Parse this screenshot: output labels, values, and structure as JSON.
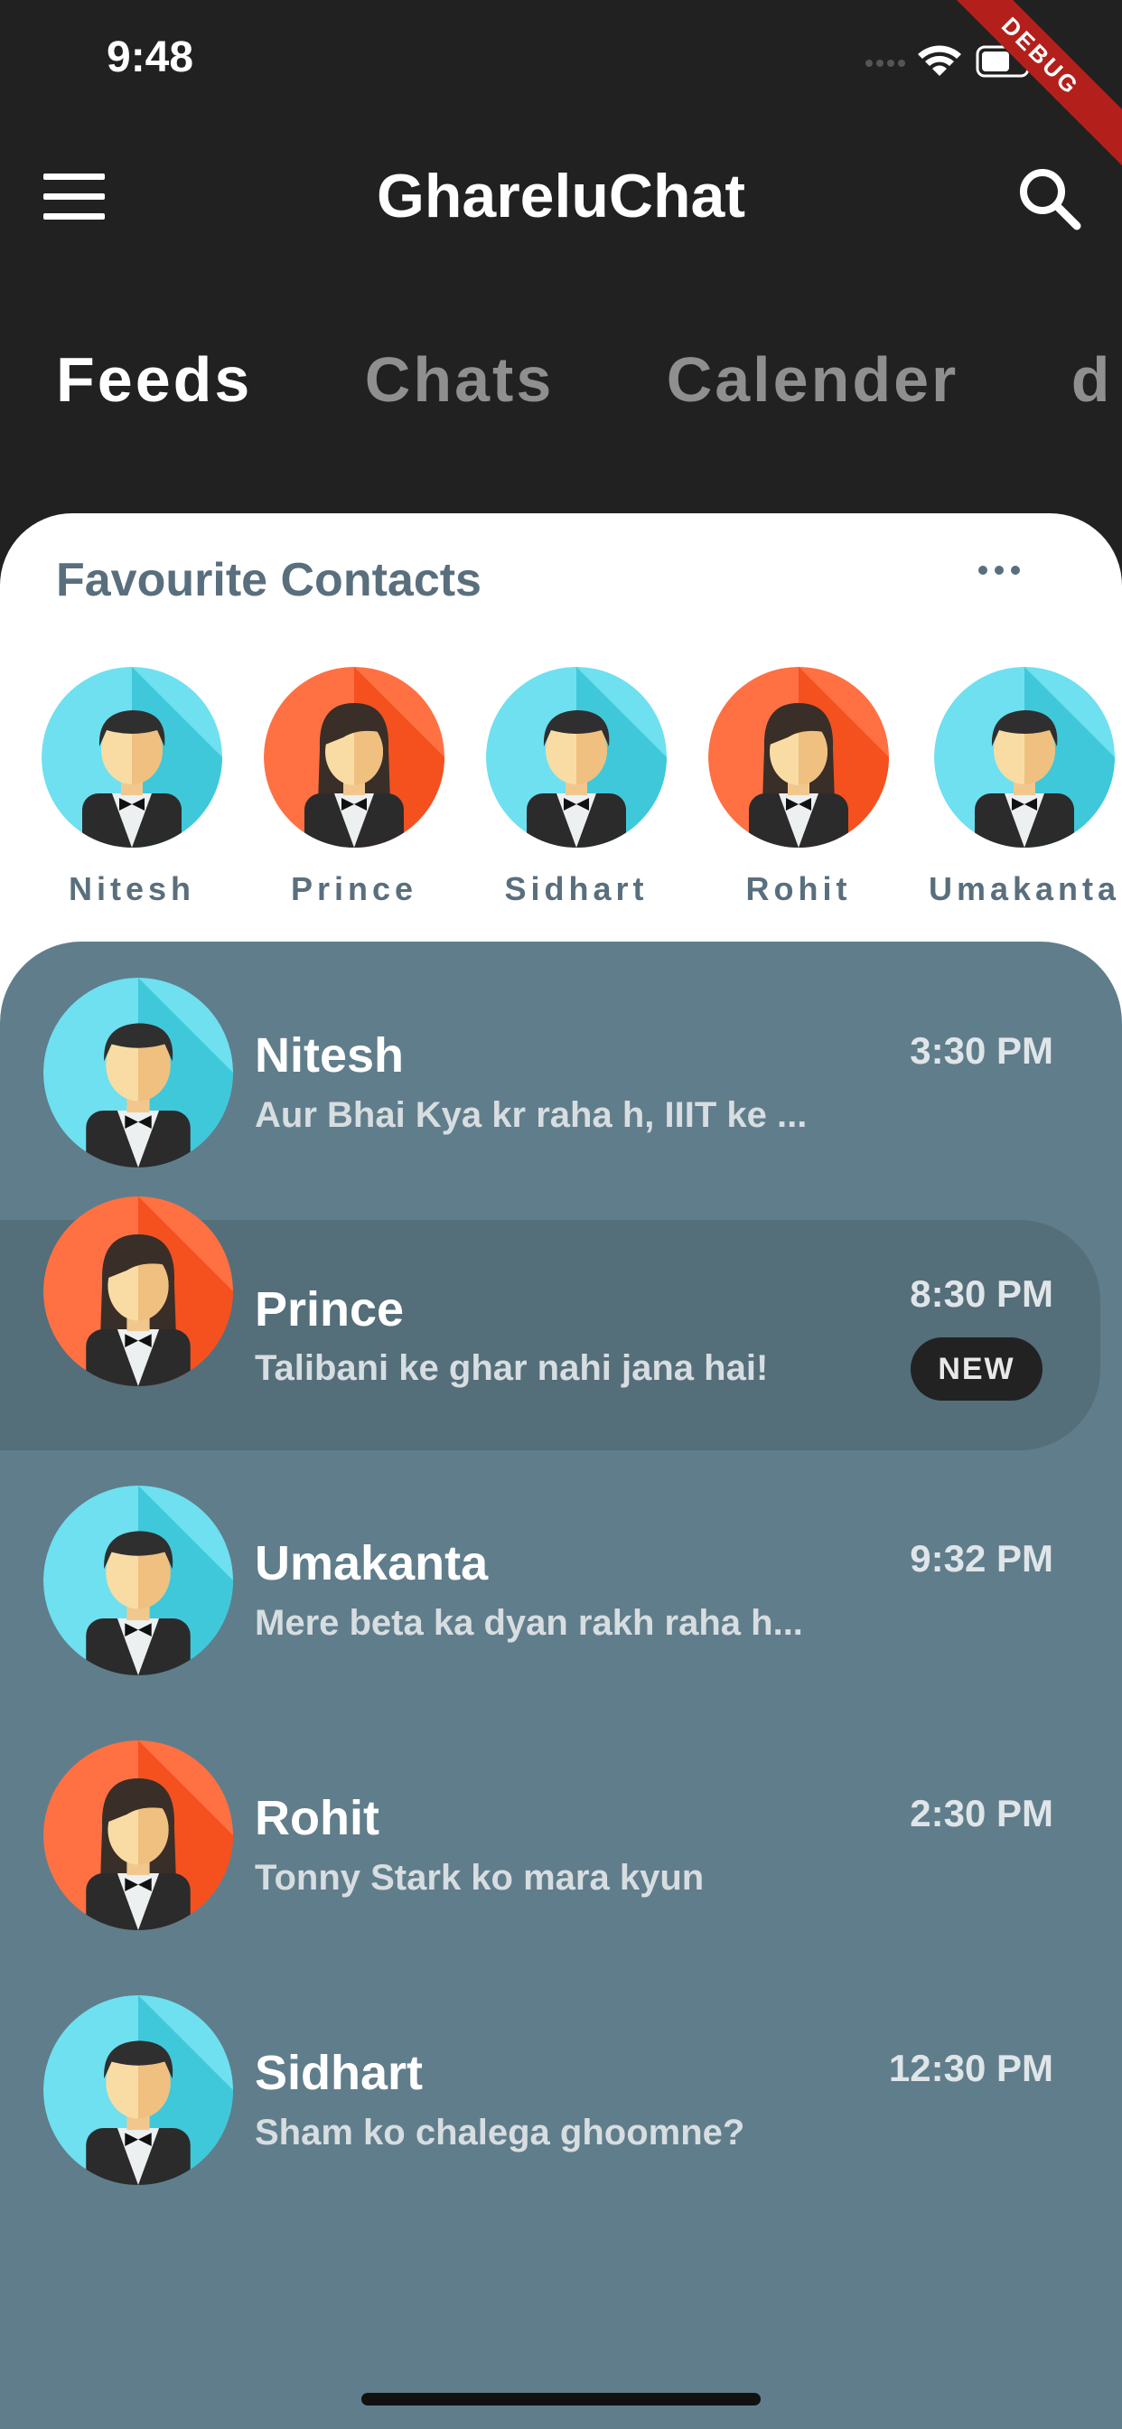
{
  "status_bar": {
    "time": "9:48",
    "debug_label": "DEBUG"
  },
  "app_bar": {
    "title": "GhareluChat",
    "menu_icon": "menu-icon",
    "search_icon": "search-icon"
  },
  "tabs": [
    {
      "label": "Feeds",
      "active": true
    },
    {
      "label": "Chats",
      "active": false
    },
    {
      "label": "Calender",
      "active": false
    },
    {
      "label": "d",
      "active": false
    }
  ],
  "favourites": {
    "header": "Favourite Contacts",
    "more_icon": "more-horizontal-icon",
    "contacts": [
      {
        "name": "Nitesh",
        "avatar": "male",
        "color": "#6ee0f0"
      },
      {
        "name": "Prince",
        "avatar": "female",
        "color": "#ff7043"
      },
      {
        "name": "Sidhart",
        "avatar": "male",
        "color": "#6ee0f0"
      },
      {
        "name": "Rohit",
        "avatar": "female",
        "color": "#ff7043"
      },
      {
        "name": "Umakanta",
        "avatar": "male",
        "color": "#6ee0f0"
      }
    ]
  },
  "chats": [
    {
      "name": "Nitesh",
      "message": "Aur Bhai Kya kr raha h, IIIT ke ...",
      "time": "3:30 PM",
      "avatar": "male",
      "unread": false
    },
    {
      "name": "Prince",
      "message": "Talibani ke ghar nahi jana hai!",
      "time": "8:30 PM",
      "avatar": "female",
      "unread": true,
      "badge": "NEW"
    },
    {
      "name": "Umakanta",
      "message": "Mere beta ka dyan rakh raha h...",
      "time": "9:32 PM",
      "avatar": "male",
      "unread": false
    },
    {
      "name": "Rohit",
      "message": "Tonny Stark ko mara kyun",
      "time": "2:30 PM",
      "avatar": "female",
      "unread": false
    },
    {
      "name": "Sidhart",
      "message": "Sham ko chalega ghoomne?",
      "time": "12:30 PM",
      "avatar": "male",
      "unread": false
    }
  ],
  "colors": {
    "background": "#212121",
    "chat_panel": "#607d8b",
    "chat_highlight": "#546e7a",
    "fav_text": "#5a6f7d",
    "male_avatar": "#6ee0f0",
    "female_avatar": "#ff7043"
  }
}
